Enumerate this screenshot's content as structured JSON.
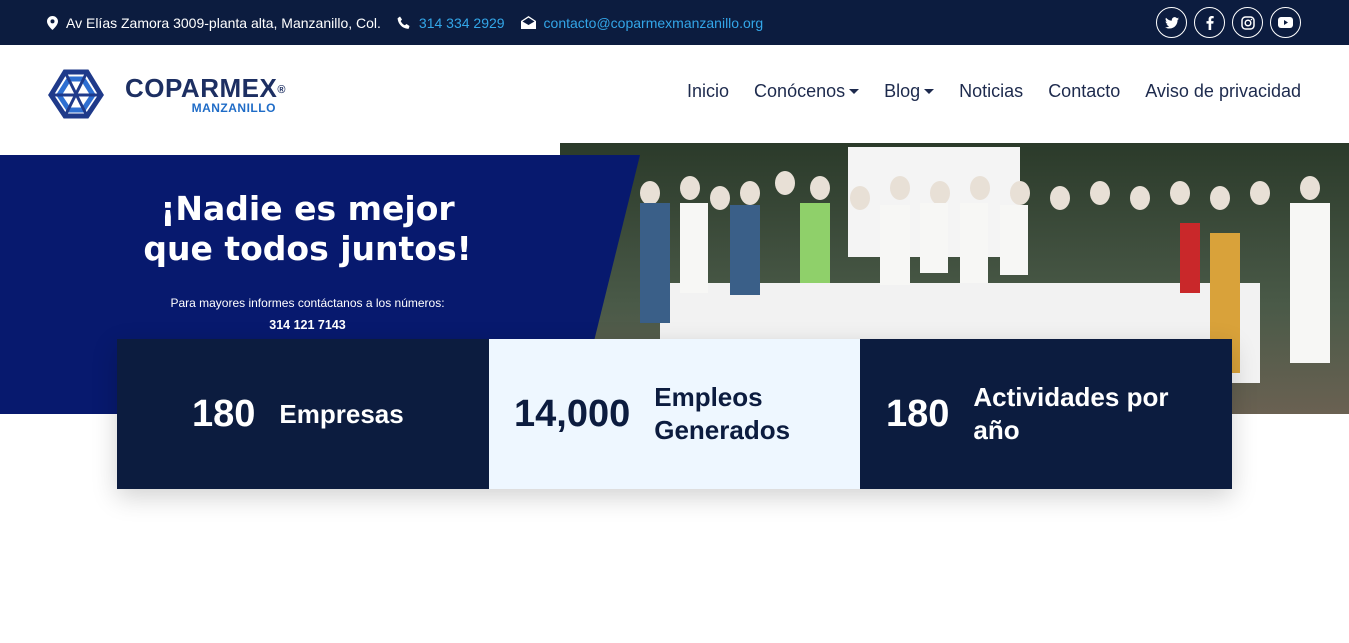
{
  "topbar": {
    "address": "Av Elías Zamora 3009-planta alta, Manzanillo, Col.",
    "phone": "314 334 2929",
    "email": "contacto@coparmexmanzanillo.org",
    "social": [
      "twitter-icon",
      "facebook-icon",
      "instagram-icon",
      "youtube-icon"
    ]
  },
  "header": {
    "logo_name": "COPARMEX",
    "logo_mark": "®",
    "logo_sub": "MANZANILLO",
    "nav": {
      "inicio": "Inicio",
      "conocenos": "Conócenos",
      "blog": "Blog",
      "noticias": "Noticias",
      "contacto": "Contacto",
      "aviso": "Aviso de privacidad"
    }
  },
  "hero": {
    "title_line1": "¡Nadie es mejor",
    "title_line2": "que todos juntos!",
    "info": "Para mayores informes contáctanos a los números:",
    "phone1": "314 121 7143"
  },
  "stats": [
    {
      "number": "180",
      "label_line1": "Empresas",
      "label_line2": ""
    },
    {
      "number": "14,000",
      "label_line1": "Empleos",
      "label_line2": "Generados"
    },
    {
      "number": "180",
      "label_line1": "Actividades por",
      "label_line2": "año"
    }
  ],
  "colors": {
    "navy": "#0c1c3f",
    "hero_blue": "#07196e",
    "link_blue": "#33a6e8",
    "light_card": "#eef7ff"
  }
}
